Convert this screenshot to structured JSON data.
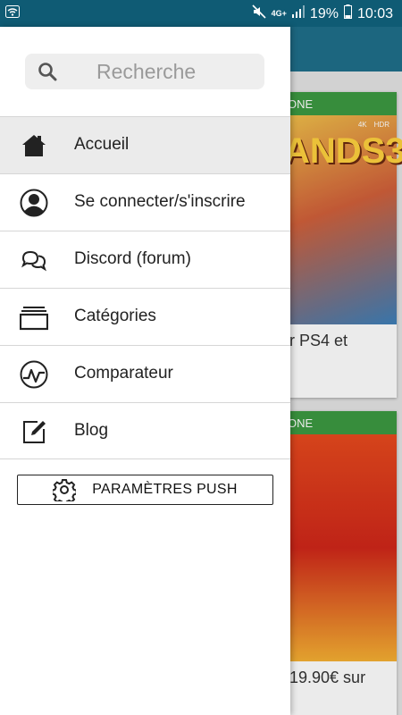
{
  "status_bar": {
    "network": "4G+",
    "battery": "19%",
    "time": "10:03",
    "icons": [
      "wifi-icon",
      "mute-icon",
      "signal-icon",
      "battery-icon"
    ]
  },
  "background": {
    "cards": [
      {
        "platform": "ONE",
        "cover_text": "ANDS3",
        "badges": [
          "4K",
          "HDR"
        ],
        "title": "r PS4 et"
      },
      {
        "platform": "ONE",
        "cover_text": "",
        "title": "19.90€ sur"
      }
    ]
  },
  "drawer": {
    "search": {
      "placeholder": "Recherche",
      "value": ""
    },
    "menu": [
      {
        "label": "Accueil",
        "icon": "home-icon",
        "active": true
      },
      {
        "label": "Se connecter/s'inscrire",
        "icon": "user-icon",
        "active": false
      },
      {
        "label": "Discord (forum)",
        "icon": "chat-icon",
        "active": false
      },
      {
        "label": "Catégories",
        "icon": "categories-icon",
        "active": false
      },
      {
        "label": "Comparateur",
        "icon": "chart-icon",
        "active": false
      },
      {
        "label": "Blog",
        "icon": "edit-icon",
        "active": false
      }
    ],
    "push_button": {
      "label": "PARAMÈTRES PUSH",
      "icon": "gear-icon"
    }
  },
  "colors": {
    "status_bar": "#0f5b74",
    "app_bar": "#1f6f8a",
    "platform_green": "#3c9a42",
    "active_item": "#ebebeb"
  }
}
